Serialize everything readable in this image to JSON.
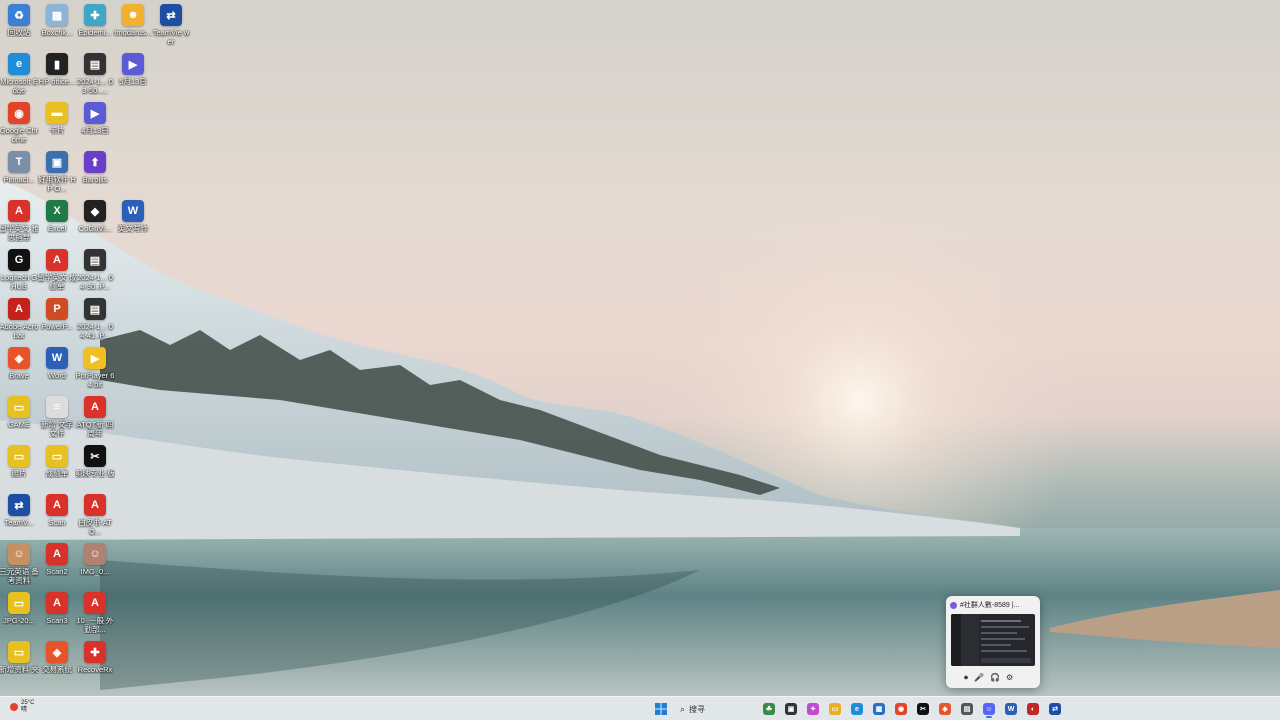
{
  "desktop": {
    "icons": [
      {
        "label": "回收站",
        "glyph": "♻",
        "color": "#3b7fd6"
      },
      {
        "label": "Boxcrik...",
        "glyph": "▦",
        "color": "#8ab4d8"
      },
      {
        "label": "Epidemi...",
        "glyph": "✚",
        "color": "#3fa6c6"
      },
      {
        "label": "tmgdarus...",
        "glyph": "☻",
        "color": "#f0b030"
      },
      {
        "label": "TeamVie wer",
        "glyph": "⇄",
        "color": "#1d4ea3"
      },
      {
        "label": "Microsoft Edge",
        "glyph": "e",
        "color": "#1f8ed8"
      },
      {
        "label": "HP office...",
        "glyph": "▮",
        "color": "#222222"
      },
      {
        "label": "2024-1... 03-50_...",
        "glyph": "▤",
        "color": "#333333"
      },
      {
        "label": "5月13日",
        "glyph": "▶",
        "color": "#5b5bd6"
      },
      {
        "label": "Google Chrome",
        "glyph": "◉",
        "color": "#e0452a"
      },
      {
        "label": "卡片",
        "glyph": "▬",
        "color": "#e8c020"
      },
      {
        "label": "4月13日",
        "glyph": "▶",
        "color": "#5b5bd6"
      },
      {
        "label": "Pinnacl...",
        "glyph": "T",
        "color": "#7a8fa8"
      },
      {
        "label": "好用软件 HP O...",
        "glyph": "▣",
        "color": "#3a6fb0"
      },
      {
        "label": "Barojlis",
        "glyph": "⬆",
        "color": "#6a3fc8"
      },
      {
        "label": "留学英文 雅思指导",
        "glyph": "A",
        "color": "#d8322a"
      },
      {
        "label": "Excel",
        "glyph": "X",
        "color": "#1f7a45"
      },
      {
        "label": "CoGuVi...",
        "glyph": "◆",
        "color": "#222222"
      },
      {
        "label": "英文写作",
        "glyph": "W",
        "color": "#2b5fb8"
      },
      {
        "label": "Logitech G HUB",
        "glyph": "G",
        "color": "#111111"
      },
      {
        "label": "留学英文 成绩单",
        "glyph": "A",
        "color": "#d8322a"
      },
      {
        "label": "2024-1... 04-30_P...",
        "glyph": "▤",
        "color": "#333333"
      },
      {
        "label": "Adobe Acrobat",
        "glyph": "A",
        "color": "#c4221a"
      },
      {
        "label": "PowerP...",
        "glyph": "P",
        "color": "#d04a22"
      },
      {
        "label": "2024-1... 04-41_P...",
        "glyph": "▤",
        "color": "#333333"
      },
      {
        "label": "Brave",
        "glyph": "◈",
        "color": "#e8532a"
      },
      {
        "label": "Word",
        "glyph": "W",
        "color": "#2b5fb8"
      },
      {
        "label": "PotPlayer 64 bit",
        "glyph": "▶",
        "color": "#f0c020"
      },
      {
        "label": "GAME",
        "glyph": "▭",
        "color": "#e8c020"
      },
      {
        "label": "新增 文字 文件",
        "glyph": "≡",
        "color": "#dddddd"
      },
      {
        "label": "ATQT新 四周年",
        "glyph": "A",
        "color": "#d8322a"
      },
      {
        "label": "照片",
        "glyph": "▭",
        "color": "#e8c020"
      },
      {
        "label": "成绩单",
        "glyph": "▭",
        "color": "#e8c020"
      },
      {
        "label": "剪映专业 版",
        "glyph": "✂",
        "color": "#111111"
      },
      {
        "label": "TeamV...",
        "glyph": "⇄",
        "color": "#1d4ea3"
      },
      {
        "label": "Scan",
        "glyph": "A",
        "color": "#d8322a"
      },
      {
        "label": "白皮书 ATQ...",
        "glyph": "A",
        "color": "#d8322a"
      },
      {
        "label": "三元英语 备考资料",
        "glyph": "☺",
        "color": "#c89060"
      },
      {
        "label": "Scan2",
        "glyph": "A",
        "color": "#d8322a"
      },
      {
        "label": "IMG_0...",
        "glyph": "☺",
        "color": "#b08070"
      },
      {
        "label": "JPG-20...",
        "glyph": "▭",
        "color": "#e8c020"
      },
      {
        "label": "Scan3",
        "glyph": "A",
        "color": "#d8322a"
      },
      {
        "label": "10_一般 外勤部...",
        "glyph": "A",
        "color": "#d8322a"
      },
      {
        "label": "新增资料 夹",
        "glyph": "▭",
        "color": "#e8c020"
      },
      {
        "label": "交易系统",
        "glyph": "◈",
        "color": "#e8532a"
      },
      {
        "label": "RecoveRx",
        "glyph": "✚",
        "color": "#d8322a"
      }
    ]
  },
  "taskbar": {
    "weather_temp": "25°C",
    "weather_desc": "晴",
    "start_glyph": "⊞",
    "search_placeholder": "搜寻",
    "search_icon": "search-icon",
    "apps": [
      {
        "name": "widgets-icon",
        "glyph": "☘",
        "color": "#3a8a4a",
        "active": false
      },
      {
        "name": "task-view-icon",
        "glyph": "▣",
        "color": "#333333",
        "active": false
      },
      {
        "name": "copilot-icon",
        "glyph": "✦",
        "color": "#c04ad0",
        "active": false
      },
      {
        "name": "file-explorer-icon",
        "glyph": "▭",
        "color": "#e8b020",
        "active": false
      },
      {
        "name": "edge-icon",
        "glyph": "e",
        "color": "#1f8ed8",
        "active": false
      },
      {
        "name": "store-icon",
        "glyph": "▦",
        "color": "#2a6fc8",
        "active": false
      },
      {
        "name": "chrome-icon",
        "glyph": "◉",
        "color": "#e0452a",
        "active": false
      },
      {
        "name": "capcut-icon",
        "glyph": "✂",
        "color": "#111111",
        "active": false
      },
      {
        "name": "brave-icon",
        "glyph": "◈",
        "color": "#e8532a",
        "active": false
      },
      {
        "name": "calculator-icon",
        "glyph": "▤",
        "color": "#555555",
        "active": false
      },
      {
        "name": "discord-icon",
        "glyph": "☺",
        "color": "#5865f2",
        "active": true
      },
      {
        "name": "word-icon",
        "glyph": "W",
        "color": "#2b5fb8",
        "active": false
      },
      {
        "name": "davinci-icon",
        "glyph": "◐",
        "color": "#c02828",
        "active": false
      },
      {
        "name": "teamviewer-icon",
        "glyph": "⇄",
        "color": "#1d4ea3",
        "active": false
      }
    ]
  },
  "preview": {
    "title": "#社群人數-8589 |...",
    "controls": [
      "⏺",
      "🎤",
      "🎧",
      "⚙"
    ]
  }
}
